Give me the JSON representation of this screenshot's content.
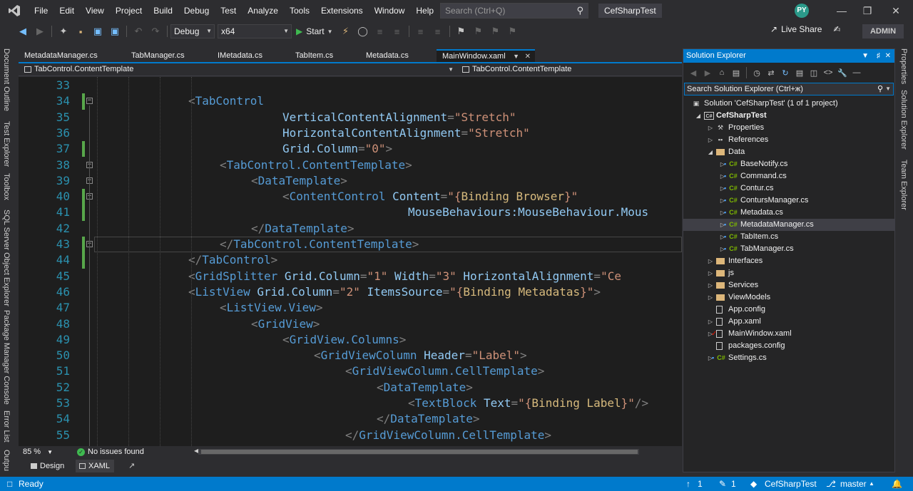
{
  "menu": {
    "items": [
      "File",
      "Edit",
      "View",
      "Project",
      "Build",
      "Debug",
      "Test",
      "Analyze",
      "Tools",
      "Extensions",
      "Window",
      "Help"
    ],
    "search_placeholder": "Search (Ctrl+Q)",
    "solution_name": "CefSharpTest",
    "avatar_initials": "PY"
  },
  "toolbar": {
    "configuration": "Debug",
    "platform": "x64",
    "start_label": "Start",
    "live_share_label": "Live Share",
    "admin_label": "ADMIN"
  },
  "left_tool_windows": [
    "Document Outline",
    "Test Explorer",
    "Toolbox",
    "SQL Server Object Explorer",
    "Package Manager Console",
    "Error List",
    "Outpu"
  ],
  "right_tool_windows": [
    "Properties",
    "Solution Explorer",
    "Team Explorer"
  ],
  "doc_tabs": [
    {
      "label": "MetadataManager.cs",
      "active": false
    },
    {
      "label": "TabManager.cs",
      "active": false
    },
    {
      "label": "IMetadata.cs",
      "active": false
    },
    {
      "label": "TabItem.cs",
      "active": false
    },
    {
      "label": "Metadata.cs",
      "active": false
    },
    {
      "label": "MainWindow.xaml",
      "active": true
    }
  ],
  "navbar": {
    "left": "TabControl.ContentTemplate",
    "right": "TabControl.ContentTemplate"
  },
  "editor": {
    "lines": [
      {
        "n": 33,
        "indent": 0,
        "tokens": []
      },
      {
        "n": 34,
        "indent": 12,
        "tokens": [
          [
            "p",
            "<"
          ],
          [
            "t",
            "TabControl"
          ]
        ]
      },
      {
        "n": 35,
        "indent": 24,
        "tokens": [
          [
            "a",
            "VerticalContentAlignment"
          ],
          [
            "p",
            "="
          ],
          [
            "v",
            "\"Stretch\""
          ]
        ]
      },
      {
        "n": 36,
        "indent": 24,
        "tokens": [
          [
            "a",
            "HorizontalContentAlignment"
          ],
          [
            "p",
            "="
          ],
          [
            "v",
            "\"Stretch\""
          ]
        ]
      },
      {
        "n": 37,
        "indent": 24,
        "tokens": [
          [
            "a",
            "Grid.Column"
          ],
          [
            "p",
            "="
          ],
          [
            "v",
            "\"0\""
          ],
          [
            "p",
            ">"
          ]
        ]
      },
      {
        "n": 38,
        "indent": 16,
        "tokens": [
          [
            "p",
            "<"
          ],
          [
            "t",
            "TabControl.ContentTemplate"
          ],
          [
            "p",
            ">"
          ]
        ]
      },
      {
        "n": 39,
        "indent": 20,
        "tokens": [
          [
            "p",
            "<"
          ],
          [
            "t",
            "DataTemplate"
          ],
          [
            "p",
            ">"
          ]
        ]
      },
      {
        "n": 40,
        "indent": 24,
        "tokens": [
          [
            "p",
            "<"
          ],
          [
            "t",
            "ContentControl"
          ],
          [
            "e",
            " "
          ],
          [
            "a",
            "Content"
          ],
          [
            "p",
            "="
          ],
          [
            "v",
            "\"{"
          ],
          [
            "b",
            "Binding Browser"
          ],
          [
            "v",
            "}\""
          ]
        ]
      },
      {
        "n": 41,
        "indent": 40,
        "tokens": [
          [
            "a",
            "MouseBehaviours:MouseBehaviour.Mous"
          ]
        ]
      },
      {
        "n": 42,
        "indent": 20,
        "tokens": [
          [
            "p",
            "</"
          ],
          [
            "t",
            "DataTemplate"
          ],
          [
            "p",
            ">"
          ]
        ]
      },
      {
        "n": 43,
        "indent": 16,
        "tokens": [
          [
            "p",
            "</"
          ],
          [
            "t",
            "TabControl.ContentTemplate"
          ],
          [
            "p",
            ">"
          ]
        ]
      },
      {
        "n": 44,
        "indent": 12,
        "tokens": [
          [
            "p",
            "</"
          ],
          [
            "t",
            "TabControl"
          ],
          [
            "p",
            ">"
          ]
        ]
      },
      {
        "n": 45,
        "indent": 12,
        "tokens": [
          [
            "p",
            "<"
          ],
          [
            "t",
            "GridSplitter"
          ],
          [
            "e",
            " "
          ],
          [
            "a",
            "Grid.Column"
          ],
          [
            "p",
            "="
          ],
          [
            "v",
            "\"1\""
          ],
          [
            "e",
            " "
          ],
          [
            "a",
            "Width"
          ],
          [
            "p",
            "="
          ],
          [
            "v",
            "\"3\""
          ],
          [
            "e",
            " "
          ],
          [
            "a",
            "HorizontalAlignment"
          ],
          [
            "p",
            "="
          ],
          [
            "v",
            "\"Ce"
          ]
        ]
      },
      {
        "n": 46,
        "indent": 12,
        "tokens": [
          [
            "p",
            "<"
          ],
          [
            "t",
            "ListView"
          ],
          [
            "e",
            " "
          ],
          [
            "a",
            "Grid.Column"
          ],
          [
            "p",
            "="
          ],
          [
            "v",
            "\"2\""
          ],
          [
            "e",
            " "
          ],
          [
            "a",
            "ItemsSource"
          ],
          [
            "p",
            "="
          ],
          [
            "v",
            "\"{"
          ],
          [
            "b",
            "Binding Metadatas"
          ],
          [
            "v",
            "}\""
          ],
          [
            "p",
            ">"
          ]
        ]
      },
      {
        "n": 47,
        "indent": 16,
        "tokens": [
          [
            "p",
            "<"
          ],
          [
            "t",
            "ListView.View"
          ],
          [
            "p",
            ">"
          ]
        ]
      },
      {
        "n": 48,
        "indent": 20,
        "tokens": [
          [
            "p",
            "<"
          ],
          [
            "t",
            "GridView"
          ],
          [
            "p",
            ">"
          ]
        ]
      },
      {
        "n": 49,
        "indent": 24,
        "tokens": [
          [
            "p",
            "<"
          ],
          [
            "t",
            "GridView.Columns"
          ],
          [
            "p",
            ">"
          ]
        ]
      },
      {
        "n": 50,
        "indent": 28,
        "tokens": [
          [
            "p",
            "<"
          ],
          [
            "t",
            "GridViewColumn"
          ],
          [
            "e",
            " "
          ],
          [
            "a",
            "Header"
          ],
          [
            "p",
            "="
          ],
          [
            "v",
            "\"Label\""
          ],
          [
            "p",
            ">"
          ]
        ]
      },
      {
        "n": 51,
        "indent": 32,
        "tokens": [
          [
            "p",
            "<"
          ],
          [
            "t",
            "GridViewColumn.CellTemplate"
          ],
          [
            "p",
            ">"
          ]
        ]
      },
      {
        "n": 52,
        "indent": 36,
        "tokens": [
          [
            "p",
            "<"
          ],
          [
            "t",
            "DataTemplate"
          ],
          [
            "p",
            ">"
          ]
        ]
      },
      {
        "n": 53,
        "indent": 40,
        "tokens": [
          [
            "p",
            "<"
          ],
          [
            "t",
            "TextBlock"
          ],
          [
            "e",
            " "
          ],
          [
            "a",
            "Text"
          ],
          [
            "p",
            "="
          ],
          [
            "v",
            "\"{"
          ],
          [
            "b",
            "Binding Label"
          ],
          [
            "v",
            "}\""
          ],
          [
            "p",
            "/>"
          ]
        ]
      },
      {
        "n": 54,
        "indent": 36,
        "tokens": [
          [
            "p",
            "</"
          ],
          [
            "t",
            "DataTemplate"
          ],
          [
            "p",
            ">"
          ]
        ]
      },
      {
        "n": 55,
        "indent": 32,
        "tokens": [
          [
            "p",
            "</"
          ],
          [
            "t",
            "GridViewColumn.CellTemplate"
          ],
          [
            "p",
            ">"
          ]
        ]
      }
    ],
    "changed_lines": [
      34,
      37,
      40,
      41,
      43,
      44
    ],
    "fold_lines": [
      34,
      38,
      39,
      40,
      43
    ]
  },
  "editor_status": {
    "zoom": "85 %",
    "issues": "No issues found"
  },
  "design_tabs": {
    "design": "Design",
    "xaml": "XAML"
  },
  "solution_explorer": {
    "title": "Solution Explorer",
    "search_placeholder": "Search Solution Explorer (Ctrl+ж)",
    "items": [
      {
        "label": "Solution 'CefSharpTest' (1 of 1 project)",
        "depth": 0,
        "arrow": "",
        "icon": "solution",
        "bold": false,
        "selected": false
      },
      {
        "label": "CefSharpTest",
        "depth": 1,
        "arrow": "down",
        "icon": "project",
        "bold": true,
        "selected": false
      },
      {
        "label": "Properties",
        "depth": 2,
        "arrow": "right",
        "icon": "wrench",
        "bold": false,
        "selected": false
      },
      {
        "label": "References",
        "depth": 2,
        "arrow": "right",
        "icon": "refs",
        "bold": false,
        "selected": false
      },
      {
        "label": "Data",
        "depth": 2,
        "arrow": "down",
        "icon": "folder",
        "bold": false,
        "selected": false
      },
      {
        "label": "BaseNotify.cs",
        "depth": 3,
        "arrow": "right",
        "icon": "cs",
        "bold": false,
        "selected": false
      },
      {
        "label": "Command.cs",
        "depth": 3,
        "arrow": "right",
        "icon": "cs",
        "bold": false,
        "selected": false
      },
      {
        "label": "Contur.cs",
        "depth": 3,
        "arrow": "right",
        "icon": "cs",
        "bold": false,
        "selected": false
      },
      {
        "label": "ContursManager.cs",
        "depth": 3,
        "arrow": "right",
        "icon": "cs",
        "bold": false,
        "selected": false
      },
      {
        "label": "Metadata.cs",
        "depth": 3,
        "arrow": "right",
        "icon": "cs",
        "bold": false,
        "selected": false
      },
      {
        "label": "MetadataManager.cs",
        "depth": 3,
        "arrow": "right",
        "icon": "cs",
        "bold": false,
        "selected": true
      },
      {
        "label": "TabItem.cs",
        "depth": 3,
        "arrow": "right",
        "icon": "cs",
        "bold": false,
        "selected": false
      },
      {
        "label": "TabManager.cs",
        "depth": 3,
        "arrow": "right",
        "icon": "cs",
        "bold": false,
        "selected": false
      },
      {
        "label": "Interfaces",
        "depth": 2,
        "arrow": "right",
        "icon": "folder",
        "bold": false,
        "selected": false
      },
      {
        "label": "js",
        "depth": 2,
        "arrow": "right",
        "icon": "folder",
        "bold": false,
        "selected": false
      },
      {
        "label": "Services",
        "depth": 2,
        "arrow": "right",
        "icon": "folder",
        "bold": false,
        "selected": false
      },
      {
        "label": "ViewModels",
        "depth": 2,
        "arrow": "right",
        "icon": "folder",
        "bold": false,
        "selected": false
      },
      {
        "label": "App.config",
        "depth": 2,
        "arrow": "",
        "icon": "file",
        "bold": false,
        "selected": false
      },
      {
        "label": "App.xaml",
        "depth": 2,
        "arrow": "right",
        "icon": "file",
        "bold": false,
        "selected": false
      },
      {
        "label": "MainWindow.xaml",
        "depth": 2,
        "arrow": "right",
        "icon": "file-mod",
        "bold": false,
        "selected": false
      },
      {
        "label": "packages.config",
        "depth": 2,
        "arrow": "",
        "icon": "file",
        "bold": false,
        "selected": false
      },
      {
        "label": "Settings.cs",
        "depth": 2,
        "arrow": "right",
        "icon": "cs",
        "bold": false,
        "selected": false
      }
    ]
  },
  "statusbar": {
    "ready": "Ready",
    "up_count": "1",
    "edit_count": "1",
    "repo": "CefSharpTest",
    "branch": "master"
  },
  "colors": {
    "accent": "#007acc",
    "editor_bg": "#1e1e1e",
    "chrome_bg": "#2d2d30"
  }
}
